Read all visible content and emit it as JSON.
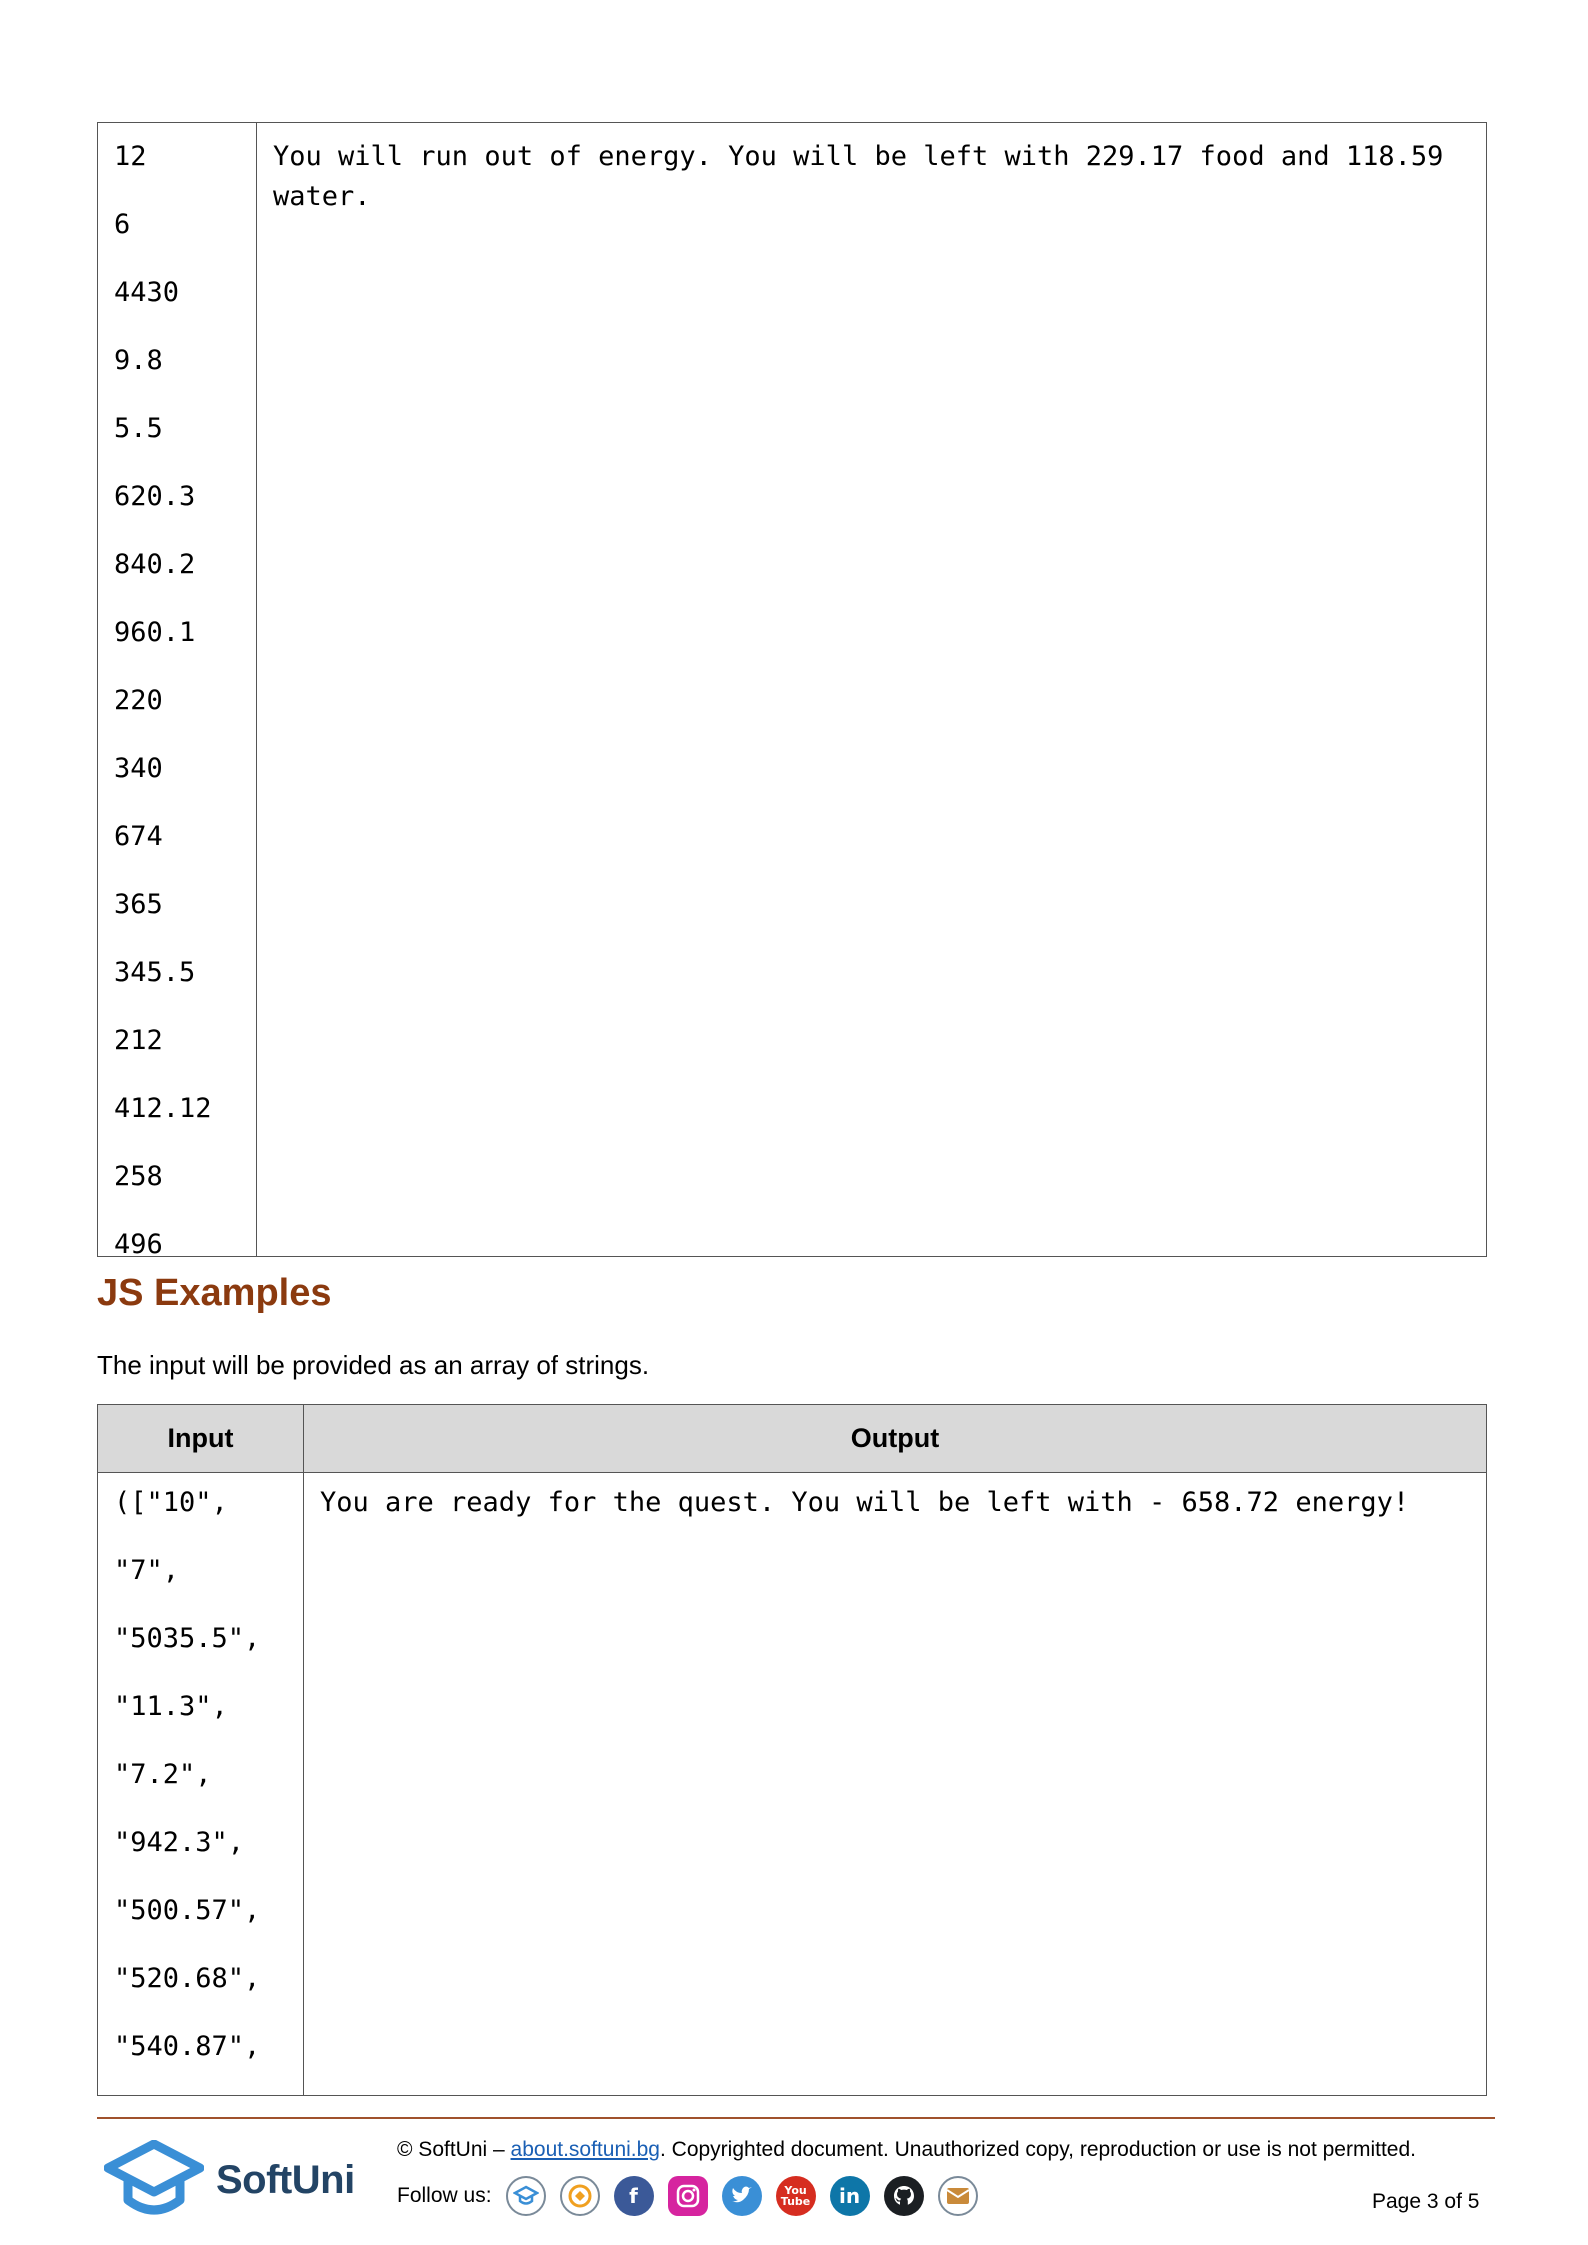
{
  "table1": {
    "inputs": [
      "12",
      "6",
      "4430",
      "9.8",
      "5.5",
      "620.3",
      "840.2",
      "960.1",
      "220",
      "340",
      "674",
      "365",
      "345.5",
      "212",
      "412.12",
      "258",
      "496"
    ],
    "output": "You will run out of energy. You will be left with 229.17 food and 118.59 water."
  },
  "js_section": {
    "heading": "JS Examples",
    "intro": "The input will be provided as an array of strings."
  },
  "table2": {
    "header_input": "Input",
    "header_output": "Output",
    "inputs": [
      "([\"10\",",
      "\"7\",",
      "\"5035.5\",",
      "\"11.3\",",
      "\"7.2\",",
      "\"942.3\",",
      "\"500.57\",",
      "\"520.68\",",
      "\"540.87\","
    ],
    "output": "You are ready for the quest. You will be left with - 658.72 energy!"
  },
  "footer": {
    "logo_text": "SoftUni",
    "copyright_prefix": "© SoftUni – ",
    "copyright_link": "about.softuni.bg",
    "copyright_suffix": ". Copyrighted document. Unauthorized copy, reproduction or use is not permitted.",
    "follow_label": "Follow us:",
    "page_label": "Page 3 of 5",
    "social_icons": [
      "softuni-icon",
      "softuni-creative-icon",
      "facebook-icon",
      "instagram-icon",
      "twitter-icon",
      "youtube-icon",
      "linkedin-icon",
      "github-icon",
      "email-icon"
    ]
  }
}
